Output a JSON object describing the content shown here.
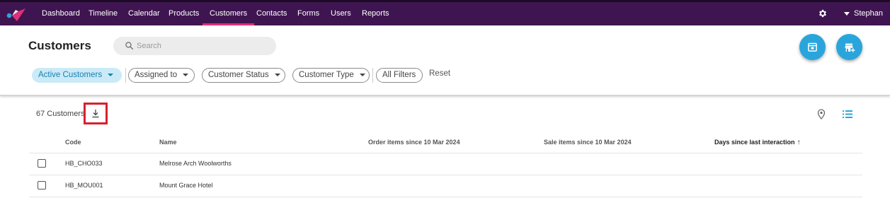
{
  "nav": {
    "items": [
      "Dashboard",
      "Timeline",
      "Calendar",
      "Products",
      "Customers",
      "Contacts",
      "Forms",
      "Users",
      "Reports"
    ],
    "active": "Customers",
    "user_name": "Stephan"
  },
  "header": {
    "title": "Customers",
    "search_placeholder": "Search"
  },
  "filters": {
    "chips": [
      "Active Customers",
      "Assigned to",
      "Customer Status",
      "Customer Type",
      "All Filters"
    ],
    "reset_label": "Reset"
  },
  "list": {
    "count_label": "67 Customers",
    "columns": [
      "Code",
      "Name",
      "Order items since 10 Mar 2024",
      "Sale items since 10 Mar 2024",
      "Days since last interaction"
    ],
    "rows": [
      {
        "code": "HB_CHO033",
        "name": "Melrose Arch Woolworths"
      },
      {
        "code": "HB_MOU001",
        "name": "Mount Grace Hotel"
      }
    ]
  },
  "colors": {
    "nav_bg": "#3f1551",
    "nav_active_underline": "#e0307a",
    "accent": "#2aa5dc",
    "active_chip_bg": "#cbeaf7",
    "highlight_box": "#d8202e"
  },
  "icons": {
    "logo": "brand-logo",
    "settings": "gear-icon",
    "search": "search-icon",
    "fab1": "calendar-icon",
    "fab2": "add-customer-icon",
    "download": "download-icon",
    "map": "map-pin-icon",
    "list": "list-view-icon"
  }
}
